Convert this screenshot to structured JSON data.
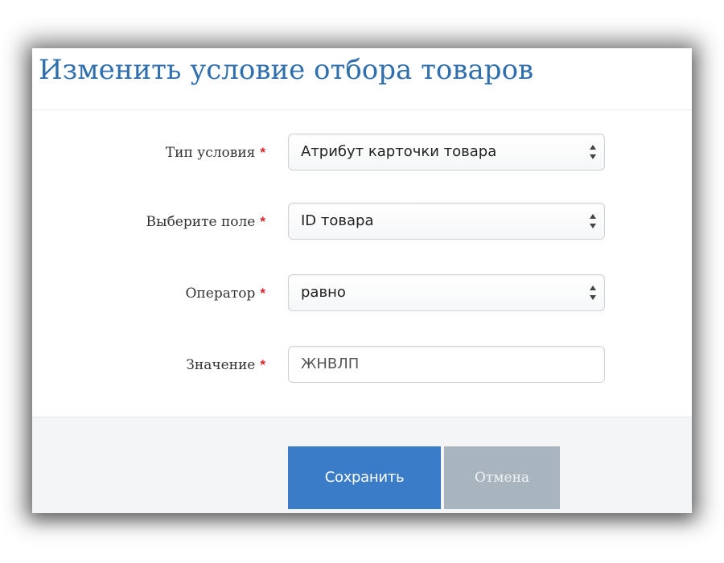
{
  "dialog": {
    "title": "Изменить условие отбора товаров",
    "required_mark": "*",
    "fields": [
      {
        "label": "Тип условия",
        "type": "select",
        "value": "Атрибут карточки товара"
      },
      {
        "label": "Выберите поле",
        "type": "select",
        "value": "ID товара"
      },
      {
        "label": "Оператор",
        "type": "select",
        "value": "равно"
      },
      {
        "label": "Значение",
        "type": "text",
        "value": "ЖНВЛП"
      }
    ],
    "buttons": {
      "save": "Сохранить",
      "cancel": "Отмена"
    },
    "colors": {
      "title": "#2f6fae",
      "required": "#e0222a",
      "save_button": "#3a7cc7",
      "cancel_button": "#a9b5be",
      "footer_bg": "#f4f5f7"
    }
  }
}
